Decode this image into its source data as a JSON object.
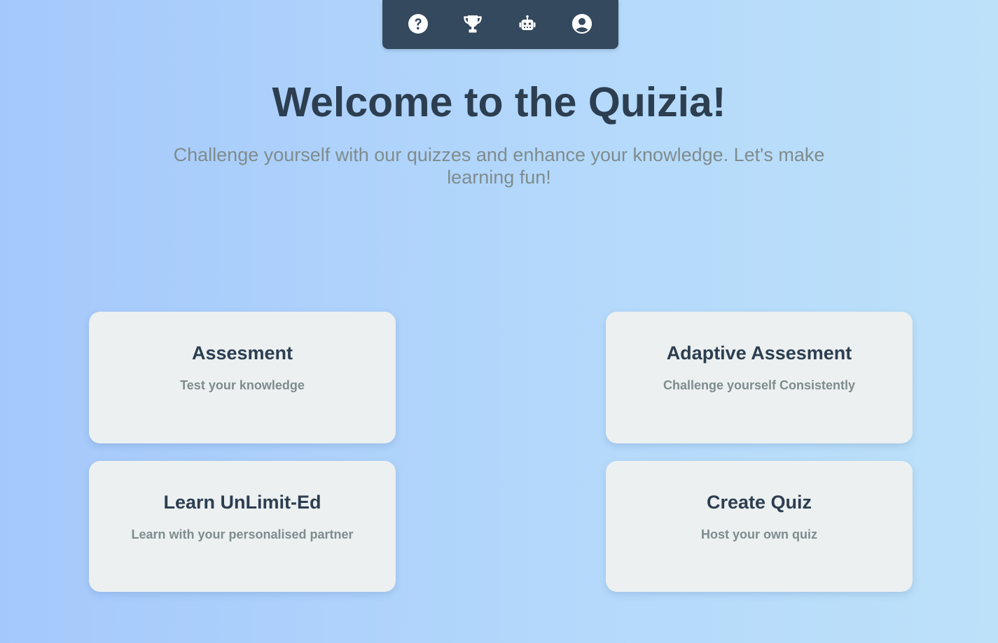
{
  "navbar": {
    "items": [
      {
        "icon": "question-circle-icon",
        "color": "#ffffff"
      },
      {
        "icon": "trophy-icon",
        "color": "#ffffff"
      },
      {
        "icon": "robot-icon",
        "color": "#ffffff"
      },
      {
        "icon": "user-circle-icon",
        "color": "#ffffff"
      }
    ],
    "background": "#34495e"
  },
  "hero": {
    "title": "Welcome to the Quizia!",
    "subtitle": "Challenge yourself with our quizzes and enhance your knowledge. Let's make learning fun!"
  },
  "cards": [
    {
      "title": "Assesment",
      "description": "Test your knowledge"
    },
    {
      "title": "Adaptive Assesment",
      "description": "Challenge yourself Consistently"
    },
    {
      "title": "Learn UnLimit-Ed",
      "description": "Learn with your personalised partner"
    },
    {
      "title": "Create Quiz",
      "description": "Host your own quiz"
    }
  ],
  "colors": {
    "title": "#2c3e50",
    "muted": "#7f8c8d",
    "card": "#ecf0f1"
  }
}
